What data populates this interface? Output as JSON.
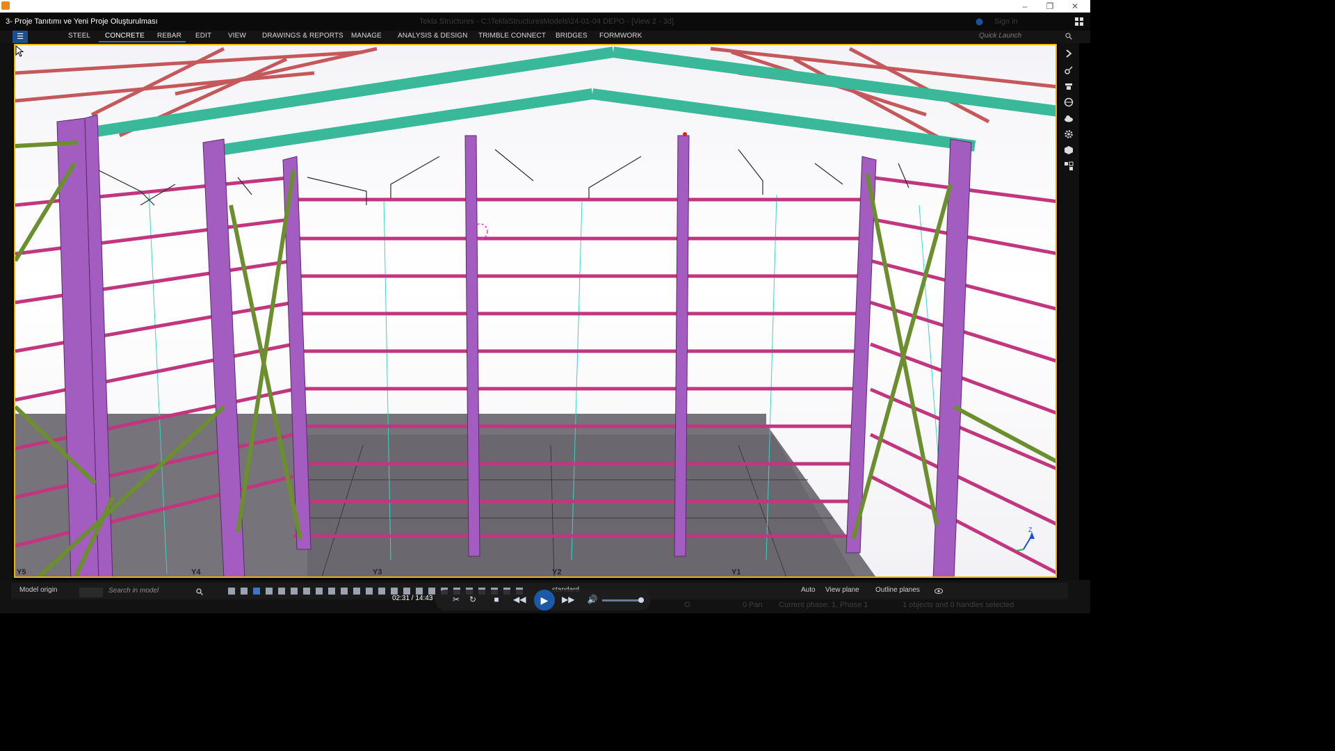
{
  "window": {
    "video_title": "3- Proje Tanıtımı ve Yeni Proje Oluşturulması",
    "app_title": "Tekla Structures - C:\\TeklaStructuresModels\\24-01-04 DEPO - [View 2 - 3d]",
    "sign_in": "Sign in",
    "controls": {
      "minimize": "–",
      "restore": "❐",
      "close": "✕"
    }
  },
  "ribbon": {
    "menu_icon": "☰",
    "tabs": [
      {
        "label": "STEEL"
      },
      {
        "label": "CONCRETE"
      },
      {
        "label": "REBAR"
      },
      {
        "label": "EDIT"
      },
      {
        "label": "VIEW"
      },
      {
        "label": "DRAWINGS & REPORTS"
      },
      {
        "label": "MANAGE"
      },
      {
        "label": "ANALYSIS & DESIGN"
      },
      {
        "label": "TRIMBLE CONNECT"
      },
      {
        "label": "BRIDGES"
      },
      {
        "label": "FORMWORK"
      }
    ],
    "active_tab": "CONCRETE",
    "quick_launch_placeholder": "Quick Launch"
  },
  "viewport": {
    "grid_labels": [
      "Y5",
      "Y4",
      "Y3",
      "Y2",
      "Y1"
    ],
    "axis_label": "Z",
    "colors": {
      "column": "#a35cbf",
      "girt": "#c1367f",
      "rafter": "#3ab89a",
      "brace": "#6b8f2e",
      "purlin": "#c4585a",
      "slab": "#6f6c72"
    }
  },
  "statusbar": {
    "model_origin": "Model origin",
    "search_placeholder": "Search in model",
    "standard": "standard",
    "auto": "Auto",
    "view_plane": "View plane",
    "outline_planes": "Outline planes",
    "pan": "0 Pan",
    "phase": "Current phase: 1, Phase 1",
    "selection": "1 objects and 0 handles selected",
    "zero": "O"
  },
  "player": {
    "time": "02:31 / 14:43"
  }
}
